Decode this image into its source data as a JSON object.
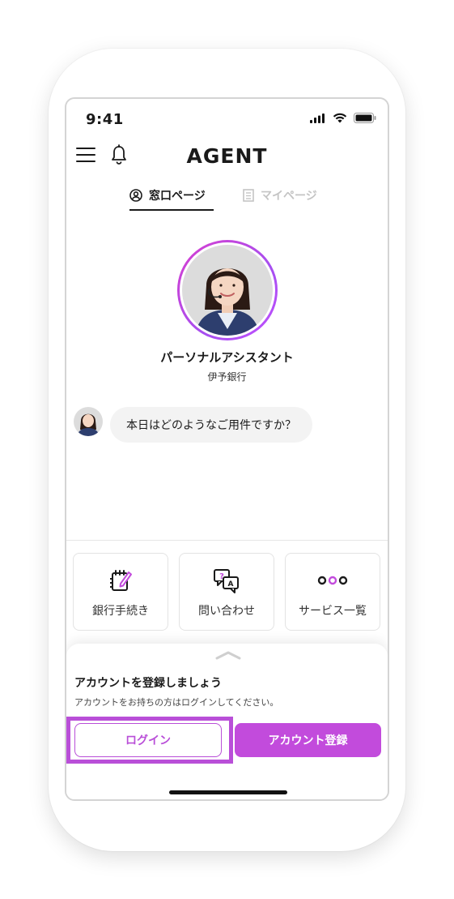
{
  "status_bar": {
    "time": "9:41"
  },
  "header": {
    "brand": "AGENT"
  },
  "tabs": [
    {
      "label": "窓口ページ",
      "icon": "user-circle-icon",
      "active": true
    },
    {
      "label": "マイページ",
      "icon": "building-icon",
      "active": false
    }
  ],
  "assistant": {
    "name": "パーソナルアシスタント",
    "bank": "伊予銀行"
  },
  "chat": {
    "message": "本日はどのようなご用件ですか？"
  },
  "quick_actions": [
    {
      "label": "銀行手続き",
      "icon": "notepad-pen-icon"
    },
    {
      "label": "問い合わせ",
      "icon": "chat-question-icon"
    },
    {
      "label": "サービス一覧",
      "icon": "three-dots-icon"
    }
  ],
  "sheet": {
    "title": "アカウントを登録しましょう",
    "subtitle": "アカウントをお持ちの方はログインしてください。",
    "login_label": "ログイン",
    "register_label": "アカウント登録"
  },
  "colors": {
    "accent": "#c24bdc",
    "accent_outline": "#b94fd8",
    "text": "#1a1a1a"
  }
}
